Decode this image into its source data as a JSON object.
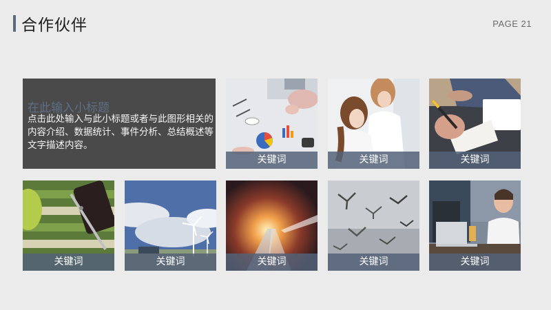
{
  "header": {
    "title": "合作伙伴",
    "page_label": "PAGE 21"
  },
  "intro": {
    "subtitle": "在此输入小标题",
    "description": "点击此处输入与此小标题或者与此图形相关的内容介绍、数据统计、事件分析、总结概述等文字描述内容。"
  },
  "tiles": [
    {
      "caption": "关键词",
      "photo": "business-meeting-charts-photo"
    },
    {
      "caption": "关键词",
      "photo": "women-at-computer-photo"
    },
    {
      "caption": "关键词",
      "photo": "hand-writing-notebook-photo"
    },
    {
      "caption": "关键词",
      "photo": "striped-cloth-phone-pen-photo"
    },
    {
      "caption": "关键词",
      "photo": "wind-turbines-sky-photo"
    },
    {
      "caption": "关键词",
      "photo": "light-trails-sunset-photo"
    },
    {
      "caption": "关键词",
      "photo": "seagulls-flying-photo"
    },
    {
      "caption": "关键词",
      "photo": "man-with-laptop-office-photo"
    }
  ],
  "colors": {
    "background": "#ebebeb",
    "accent": "#5b6b7f",
    "text_box": "#4a4a4a",
    "caption_bar": "#546278"
  }
}
